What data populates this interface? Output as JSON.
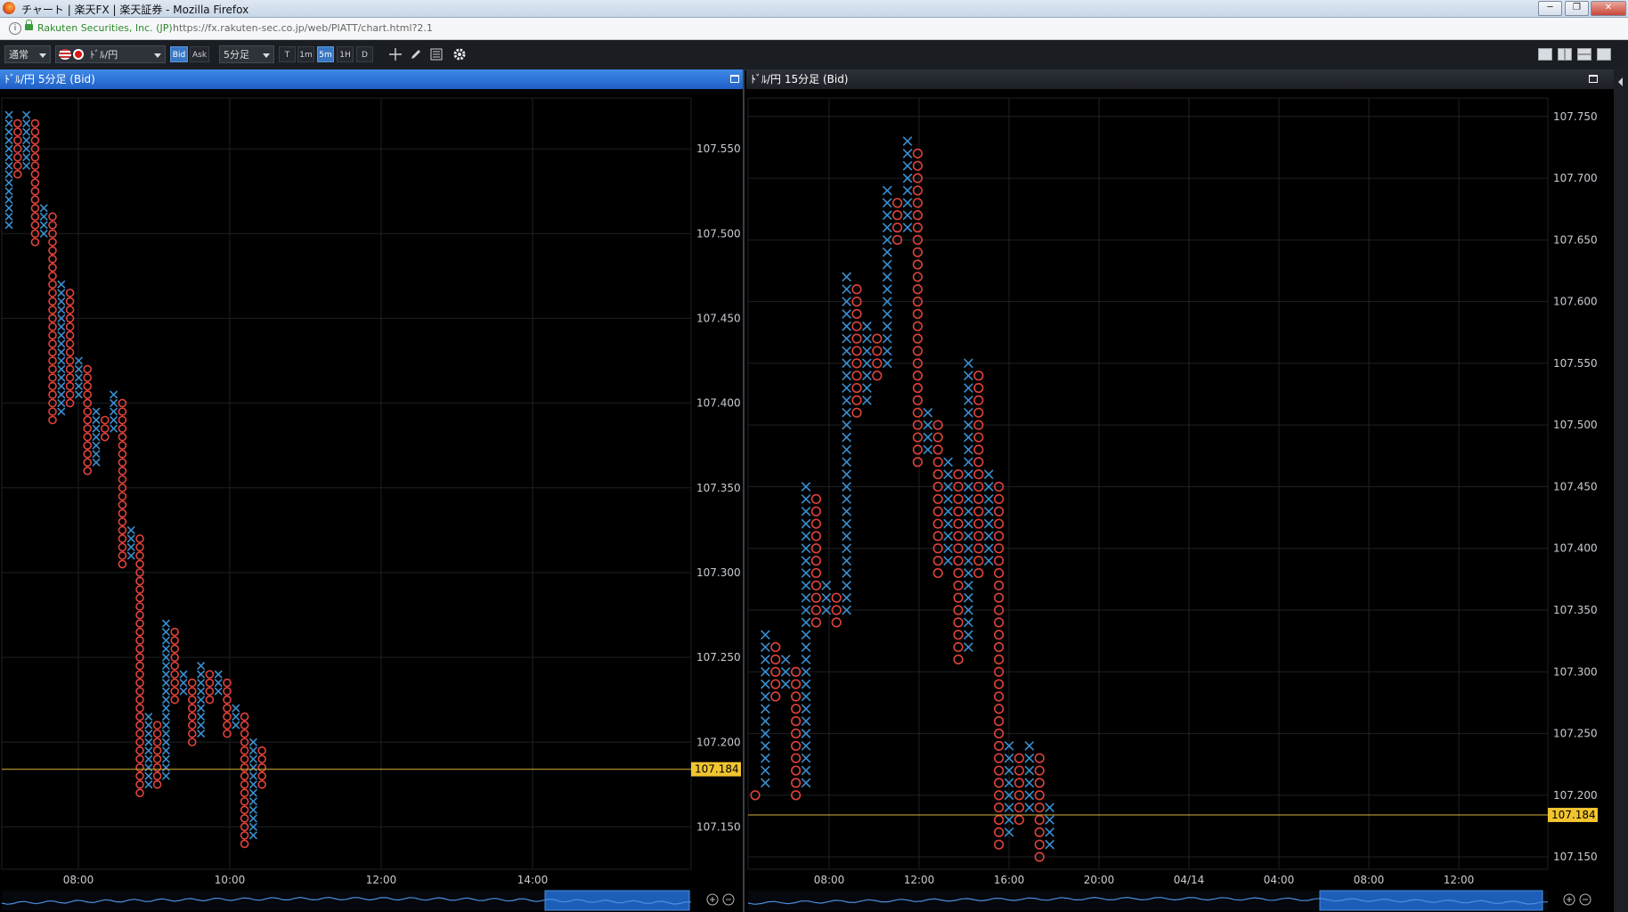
{
  "window": {
    "title": "チャート | 楽天FX | 楽天証券 - Mozilla Firefox",
    "buttons": [
      "─",
      "❐",
      "✕"
    ]
  },
  "address_bar": {
    "org": "Rakuten Securities, Inc. (JP)",
    "url": "https://fx.rakuten-sec.co.jp/web/PIATT/chart.html?2.1"
  },
  "toolbar": {
    "mode": "通常",
    "pair": "ﾄﾞﾙ/円",
    "bid": "Bid",
    "ask": "Ask",
    "timeframe": "5分足",
    "periods": [
      "T",
      "1m",
      "5m",
      "1H",
      "D"
    ],
    "active_period": "5m",
    "colors": {
      "accent": "#3b78c4",
      "x_mark": "#3a8fd0",
      "o_mark": "#e0433a",
      "price_line": "#d9b23a",
      "price_tag": "#f2c530"
    }
  },
  "left_panel": {
    "title": "ﾄﾞﾙ/円 5分足 (Bid)",
    "active": true,
    "price_label": "107.184",
    "chart_data": {
      "type": "point-and-figure",
      "box_size": 0.005,
      "y_ticks": [
        107.15,
        107.2,
        107.25,
        107.3,
        107.35,
        107.4,
        107.45,
        107.5,
        107.55
      ],
      "ylim": [
        107.125,
        107.58
      ],
      "x_ticks": [
        "08:00",
        "10:00",
        "12:00",
        "14:00"
      ],
      "current_price": 107.184,
      "columns": [
        {
          "type": "X",
          "low": 107.505,
          "high": 107.57
        },
        {
          "type": "O",
          "high": 107.565,
          "low": 107.535
        },
        {
          "type": "X",
          "low": 107.54,
          "high": 107.57
        },
        {
          "type": "O",
          "high": 107.565,
          "low": 107.495
        },
        {
          "type": "X",
          "low": 107.5,
          "high": 107.515
        },
        {
          "type": "O",
          "high": 107.51,
          "low": 107.39
        },
        {
          "type": "X",
          "low": 107.395,
          "high": 107.47
        },
        {
          "type": "O",
          "high": 107.465,
          "low": 107.4
        },
        {
          "type": "X",
          "low": 107.405,
          "high": 107.425
        },
        {
          "type": "O",
          "high": 107.42,
          "low": 107.36
        },
        {
          "type": "X",
          "low": 107.365,
          "high": 107.395
        },
        {
          "type": "O",
          "high": 107.39,
          "low": 107.38
        },
        {
          "type": "X",
          "low": 107.385,
          "high": 107.405
        },
        {
          "type": "O",
          "high": 107.4,
          "low": 107.305
        },
        {
          "type": "X",
          "low": 107.31,
          "high": 107.325
        },
        {
          "type": "O",
          "high": 107.32,
          "low": 107.17
        },
        {
          "type": "X",
          "low": 107.175,
          "high": 107.215
        },
        {
          "type": "O",
          "high": 107.21,
          "low": 107.175
        },
        {
          "type": "X",
          "low": 107.18,
          "high": 107.27
        },
        {
          "type": "O",
          "high": 107.265,
          "low": 107.225
        },
        {
          "type": "X",
          "low": 107.23,
          "high": 107.24
        },
        {
          "type": "O",
          "high": 107.235,
          "low": 107.2
        },
        {
          "type": "X",
          "low": 107.205,
          "high": 107.245
        },
        {
          "type": "O",
          "high": 107.24,
          "low": 107.225
        },
        {
          "type": "X",
          "low": 107.23,
          "high": 107.24
        },
        {
          "type": "O",
          "high": 107.235,
          "low": 107.205
        },
        {
          "type": "X",
          "low": 107.21,
          "high": 107.22
        },
        {
          "type": "O",
          "high": 107.215,
          "low": 107.14
        },
        {
          "type": "X",
          "low": 107.145,
          "high": 107.2
        },
        {
          "type": "O",
          "high": 107.195,
          "low": 107.175
        }
      ]
    }
  },
  "right_panel": {
    "title": "ﾄﾞﾙ/円 15分足 (Bid)",
    "active": false,
    "price_label": "107.184",
    "chart_data": {
      "type": "point-and-figure",
      "box_size": 0.01,
      "y_ticks": [
        107.15,
        107.2,
        107.25,
        107.3,
        107.35,
        107.4,
        107.45,
        107.5,
        107.55,
        107.6,
        107.65,
        107.7,
        107.75
      ],
      "ylim": [
        107.14,
        107.765
      ],
      "x_ticks": [
        "08:00",
        "12:00",
        "16:00",
        "20:00",
        "04/14",
        "04:00",
        "08:00",
        "12:00"
      ],
      "current_price": 107.184,
      "columns": [
        {
          "type": "O",
          "high": 107.2,
          "low": 107.2
        },
        {
          "type": "X",
          "low": 107.21,
          "high": 107.33
        },
        {
          "type": "O",
          "high": 107.32,
          "low": 107.28
        },
        {
          "type": "X",
          "low": 107.29,
          "high": 107.31
        },
        {
          "type": "O",
          "high": 107.3,
          "low": 107.2
        },
        {
          "type": "X",
          "low": 107.21,
          "high": 107.45
        },
        {
          "type": "O",
          "high": 107.44,
          "low": 107.34
        },
        {
          "type": "X",
          "low": 107.35,
          "high": 107.37
        },
        {
          "type": "O",
          "high": 107.36,
          "low": 107.34
        },
        {
          "type": "X",
          "low": 107.35,
          "high": 107.62
        },
        {
          "type": "O",
          "high": 107.61,
          "low": 107.51
        },
        {
          "type": "X",
          "low": 107.52,
          "high": 107.58
        },
        {
          "type": "O",
          "high": 107.57,
          "low": 107.54
        },
        {
          "type": "X",
          "low": 107.55,
          "high": 107.69
        },
        {
          "type": "O",
          "high": 107.68,
          "low": 107.65
        },
        {
          "type": "X",
          "low": 107.66,
          "high": 107.73
        },
        {
          "type": "O",
          "high": 107.72,
          "low": 107.47
        },
        {
          "type": "X",
          "low": 107.48,
          "high": 107.51
        },
        {
          "type": "O",
          "high": 107.5,
          "low": 107.38
        },
        {
          "type": "X",
          "low": 107.39,
          "high": 107.47
        },
        {
          "type": "O",
          "high": 107.46,
          "low": 107.31
        },
        {
          "type": "X",
          "low": 107.32,
          "high": 107.55
        },
        {
          "type": "O",
          "high": 107.54,
          "low": 107.38
        },
        {
          "type": "X",
          "low": 107.39,
          "high": 107.46
        },
        {
          "type": "O",
          "high": 107.45,
          "low": 107.16
        },
        {
          "type": "X",
          "low": 107.17,
          "high": 107.24
        },
        {
          "type": "O",
          "high": 107.23,
          "low": 107.18
        },
        {
          "type": "X",
          "low": 107.19,
          "high": 107.24
        },
        {
          "type": "O",
          "high": 107.23,
          "low": 107.15
        },
        {
          "type": "X",
          "low": 107.16,
          "high": 107.19
        }
      ]
    }
  }
}
